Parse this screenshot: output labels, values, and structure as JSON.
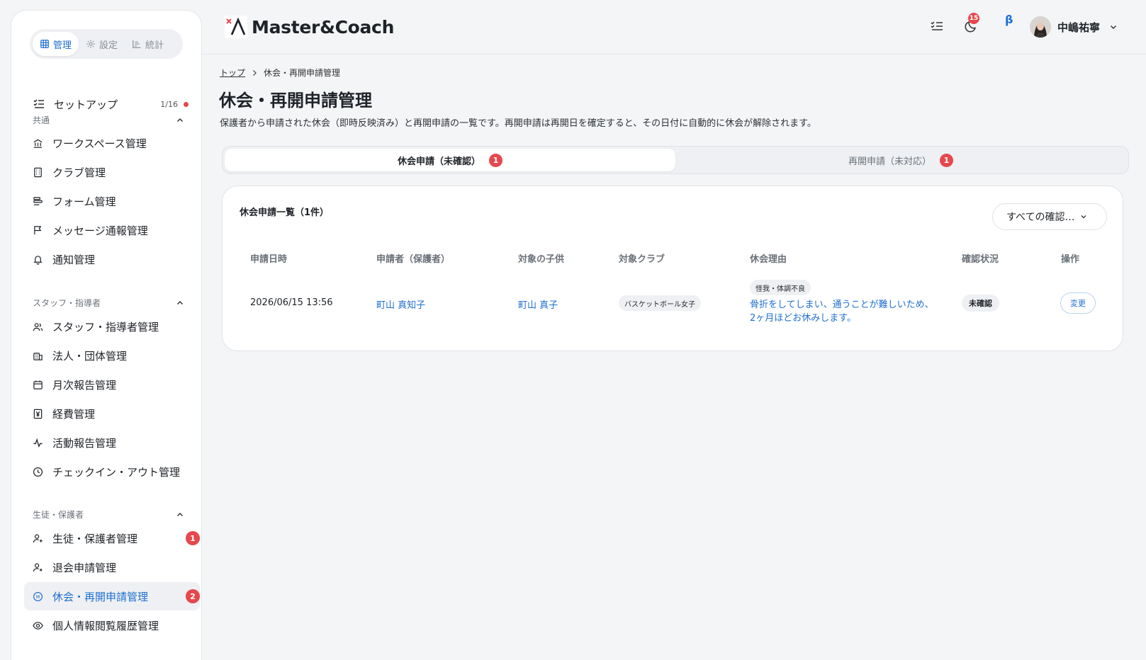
{
  "sidebar": {
    "modes": [
      {
        "label": "管理",
        "icon": "grid-icon"
      },
      {
        "label": "設定",
        "icon": "gear-icon"
      },
      {
        "label": "統計",
        "icon": "bar-chart-icon"
      }
    ],
    "setup": {
      "label": "セットアップ",
      "count": "1/16"
    },
    "sections": [
      {
        "title": "共通"
      },
      {
        "title": "スタッフ・指導者"
      },
      {
        "title": "生徒・保護者"
      }
    ],
    "items": [
      {
        "label": "ワークスペース管理",
        "icon": "bank-icon"
      },
      {
        "label": "クラブ管理",
        "icon": "building-icon"
      },
      {
        "label": "フォーム管理",
        "icon": "form-icon"
      },
      {
        "label": "メッセージ通報管理",
        "icon": "flag-icon"
      },
      {
        "label": "通知管理",
        "icon": "bell-icon"
      },
      {
        "label": "スタッフ・指導者管理",
        "icon": "users-icon"
      },
      {
        "label": "法人・団体管理",
        "icon": "office-icon"
      },
      {
        "label": "月次報告管理",
        "icon": "calendar-icon"
      },
      {
        "label": "経費管理",
        "icon": "yen-icon"
      },
      {
        "label": "活動報告管理",
        "icon": "activity-icon"
      },
      {
        "label": "チェックイン・アウト管理",
        "icon": "clock-icon"
      },
      {
        "label": "生徒・保護者管理",
        "icon": "user-plus-icon",
        "badge": "1"
      },
      {
        "label": "退会申請管理",
        "icon": "user-x-icon"
      },
      {
        "label": "休会・再開申請管理",
        "icon": "pause-circle-icon",
        "badge": "2"
      },
      {
        "label": "個人情報閲覧履歴管理",
        "icon": "eye-icon"
      }
    ]
  },
  "header": {
    "brand": "Master&Coach",
    "task_badge": "15",
    "beta": "β",
    "user_name": "中嶋祐寧"
  },
  "breadcrumb": {
    "home": "トップ",
    "current": "休会・再開申請管理"
  },
  "page": {
    "title": "休会・再開申請管理",
    "description": "保護者から申請された休会（即時反映済み）と再開申請の一覧です。再開申請は再開日を確定すると、その日付に自動的に休会が解除されます。"
  },
  "tabs": [
    {
      "label": "休会申請（未確認）",
      "badge": "1",
      "active": true
    },
    {
      "label": "再開申請（未対応）",
      "badge": "1",
      "active": false
    }
  ],
  "table": {
    "title": "休会申請一覧（1件）",
    "filter": "すべての確認…",
    "columns": [
      "申請日時",
      "申請者（保護者）",
      "対象の子供",
      "対象クラブ",
      "休会理由",
      "確認状況",
      "操作"
    ],
    "rows": [
      {
        "date": "2026/06/15 13:56",
        "applicant": "町山 真知子",
        "child": "町山 真子",
        "club": "バスケットボール女子",
        "reason_tag": "怪我・体調不良",
        "reason_line1": "骨折をしてしまい、通うことが難しいため、",
        "reason_line2": "2ヶ月ほどお休みします。",
        "status": "未確認",
        "action": "変更"
      }
    ]
  },
  "colors": {
    "accent": "#1f6fd1",
    "badge": "#e5484d",
    "background": "#f4f5f7"
  }
}
